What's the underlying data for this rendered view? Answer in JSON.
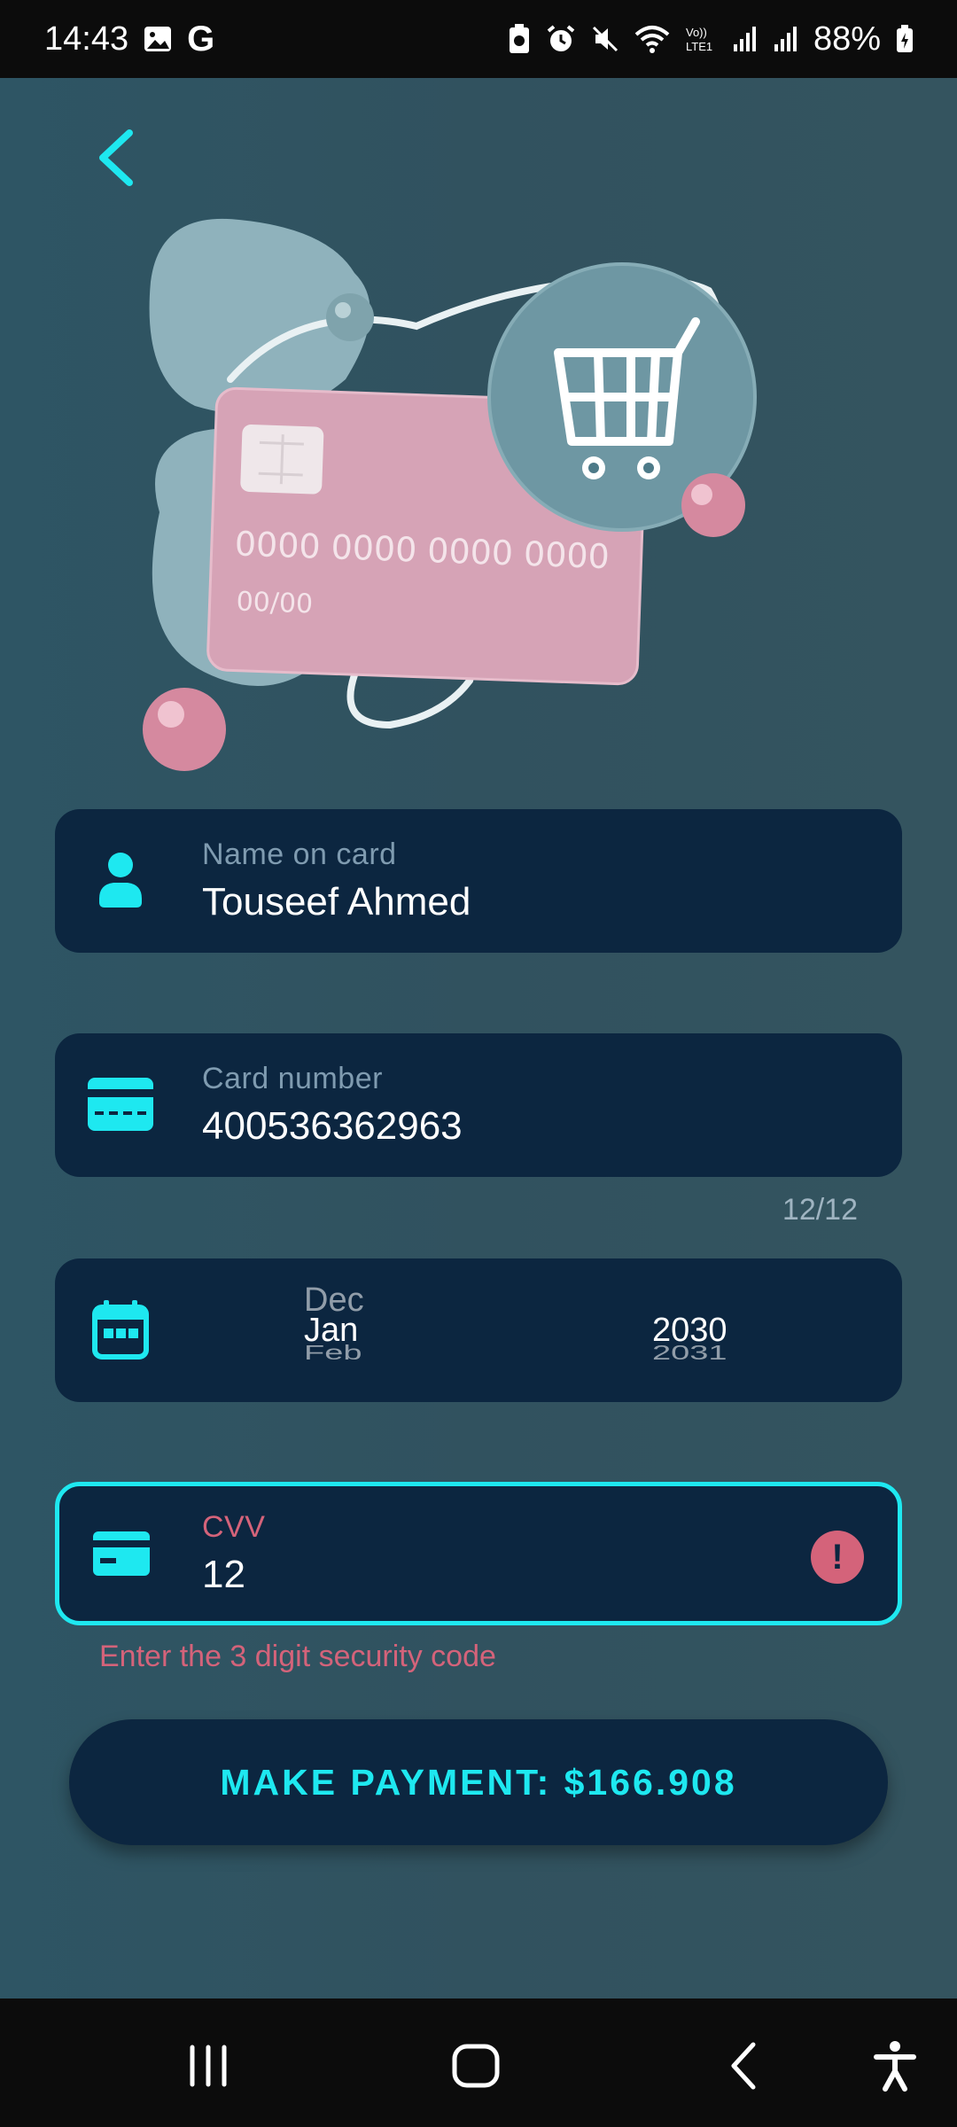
{
  "status_bar": {
    "time": "14:43",
    "battery": "88%",
    "icons": [
      "image-icon",
      "google-icon",
      "battery-saver-icon",
      "alarm-icon",
      "mute-icon",
      "wifi-icon",
      "volte-icon",
      "signal-icon",
      "signal-icon",
      "battery-icon"
    ],
    "google_letter": "G",
    "volte_text": "Vo))\nLTE1"
  },
  "hero": {
    "card_number": "0000 0000 0000 0000",
    "card_expiry": "00/00"
  },
  "form": {
    "name": {
      "label": "Name on card",
      "value": "Touseef Ahmed",
      "icon": "person-icon"
    },
    "card": {
      "label": "Card number",
      "value": "400536362963",
      "icon": "credit-card-icon",
      "counter": "12/12"
    },
    "expiry": {
      "icon": "calendar-icon",
      "months": [
        "Dec",
        "Jan",
        "Feb"
      ],
      "years": [
        "2030",
        "2031"
      ]
    },
    "cvv": {
      "label": "CVV",
      "value": "12",
      "icon": "credit-card-icon",
      "error": "Enter the 3 digit security code"
    }
  },
  "pay_button": {
    "label": "MAKE PAYMENT: $166.908"
  },
  "colors": {
    "accent": "#1ee8f0",
    "error": "#d4637a",
    "field_bg": "#0c2640",
    "screen_bg": "#2f5563"
  }
}
